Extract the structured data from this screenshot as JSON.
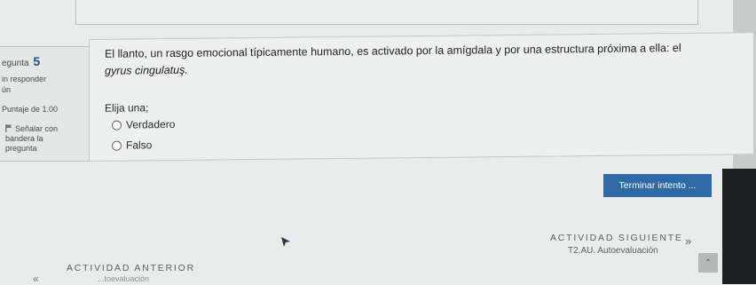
{
  "question_info": {
    "number_label": "egunta",
    "number": "5",
    "status_line1": "in responder",
    "status_line2": "ún",
    "points": "Puntaje de 1.00",
    "flag_line1": "Señalar con",
    "flag_line2": "bandera la",
    "flag_line3": "pregunta"
  },
  "question": {
    "text_line1": "El llanto, un rasgo emocional típicamente humano, es activado por la amígdala y por una estructura próxima a ella: el",
    "text_line2": "gyrus cingulatuş.",
    "prompt": "Elija una;",
    "options": [
      {
        "label": "Verdadero",
        "selected": false
      },
      {
        "label": "Falso",
        "selected": false
      }
    ]
  },
  "actions": {
    "finish_attempt": "Terminar intento ..."
  },
  "navigation": {
    "next_heading": "ACTIVIDAD SIGUIENTE",
    "next_name": "T2.AU. Autoevaluación",
    "next_arrow": "»",
    "prev_heading": "ACTIVIDAD ANTERIOR",
    "prev_arrow": "«",
    "prev_name": "...toevaluación"
  },
  "colors": {
    "accent": "#2d6aa6",
    "question_number": "#1b4f8a"
  }
}
